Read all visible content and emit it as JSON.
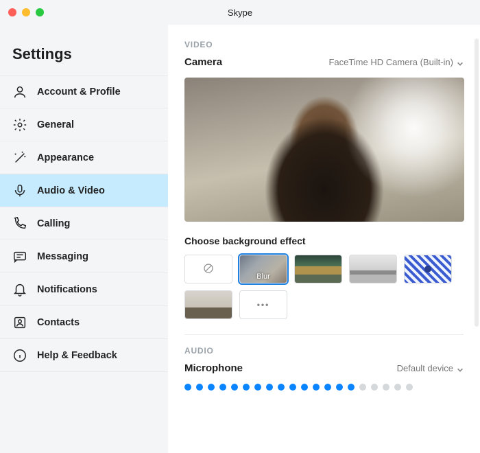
{
  "window": {
    "title": "Skype"
  },
  "sidebar": {
    "heading": "Settings",
    "items": [
      {
        "label": "Account & Profile",
        "icon": "person-icon"
      },
      {
        "label": "General",
        "icon": "gear-icon"
      },
      {
        "label": "Appearance",
        "icon": "wand-icon"
      },
      {
        "label": "Audio & Video",
        "icon": "mic-icon",
        "active": true
      },
      {
        "label": "Calling",
        "icon": "phone-icon"
      },
      {
        "label": "Messaging",
        "icon": "chat-icon"
      },
      {
        "label": "Notifications",
        "icon": "bell-icon"
      },
      {
        "label": "Contacts",
        "icon": "contacts-icon"
      },
      {
        "label": "Help & Feedback",
        "icon": "info-icon"
      }
    ]
  },
  "video": {
    "section_label": "VIDEO",
    "camera_title": "Camera",
    "camera_value": "FaceTime HD Camera (Built-in)",
    "bg_heading": "Choose background effect",
    "blur_label": "Blur",
    "more_label": "•••"
  },
  "audio": {
    "section_label": "AUDIO",
    "mic_title": "Microphone",
    "mic_value": "Default device",
    "level_active": 15,
    "level_total": 20
  }
}
